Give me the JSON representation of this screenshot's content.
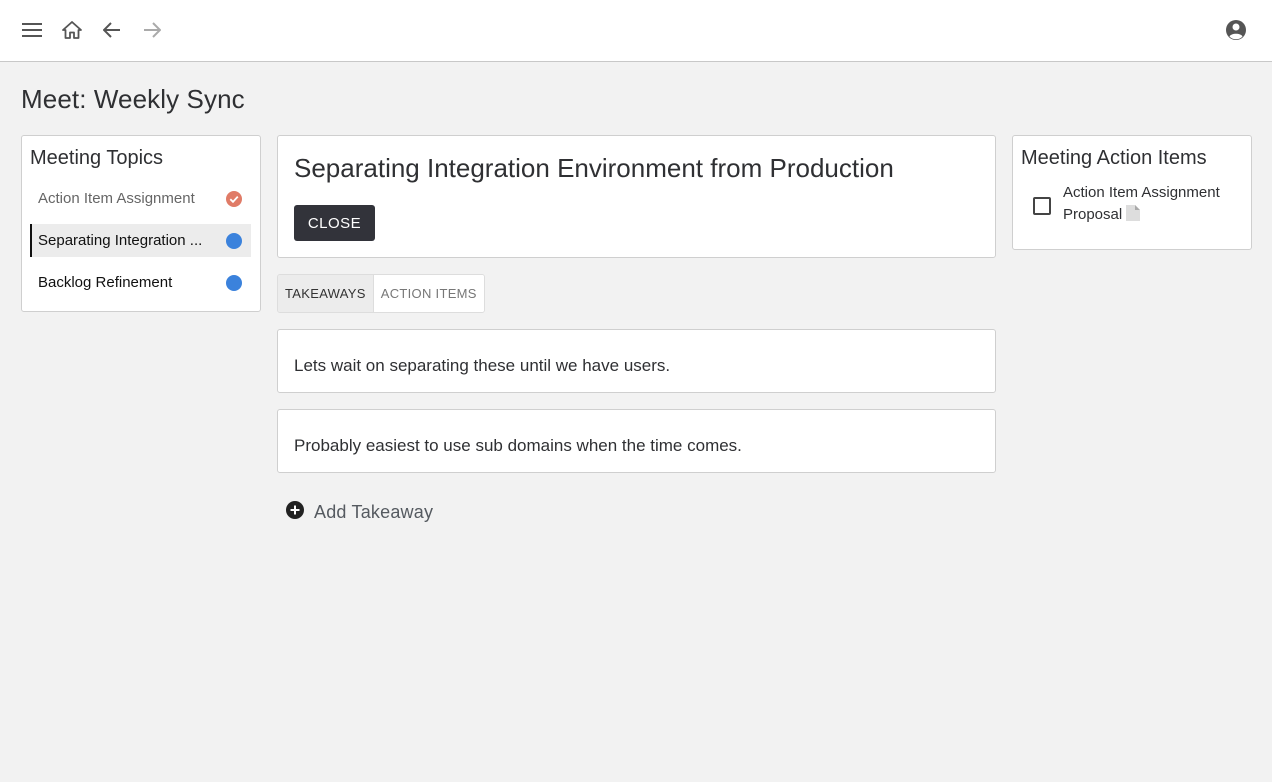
{
  "topbar": {
    "menu_icon": "hamburger-menu-icon",
    "home_icon": "home-icon",
    "back_icon": "arrow-left-icon",
    "forward_icon": "arrow-right-icon",
    "account_icon": "account-circle-icon"
  },
  "page": {
    "title": "Meet: Weekly Sync"
  },
  "topics": {
    "title": "Meeting Topics",
    "items": [
      {
        "label": "Action Item Assignment",
        "state": "done",
        "status_color": "#e07b67"
      },
      {
        "label": "Separating Integration ...",
        "state": "active",
        "status_color": "#3b82dc"
      },
      {
        "label": "Backlog Refinement",
        "state": "open",
        "status_color": "#3b82dc"
      }
    ]
  },
  "current_topic": {
    "heading": "Separating Integration Environment from Production",
    "close_label": "CLOSE"
  },
  "tabs": [
    {
      "label": "TAKEAWAYS",
      "active": true
    },
    {
      "label": "ACTION ITEMS",
      "active": false
    }
  ],
  "takeaways": [
    {
      "text": "Lets wait on separating these until we have users."
    },
    {
      "text": "Probably easiest to use sub domains when the time comes."
    }
  ],
  "add_takeaway": {
    "label": "Add Takeaway",
    "icon": "plus-circle-icon"
  },
  "action_items": {
    "title": "Meeting Action Items",
    "items": [
      {
        "text": "Action Item Assignment Proposal",
        "checked": false,
        "icon": "document-icon"
      }
    ]
  },
  "colors": {
    "accent_dark": "#32333a",
    "done": "#e07b67",
    "open": "#3b82dc",
    "background": "#f2f2f2"
  }
}
